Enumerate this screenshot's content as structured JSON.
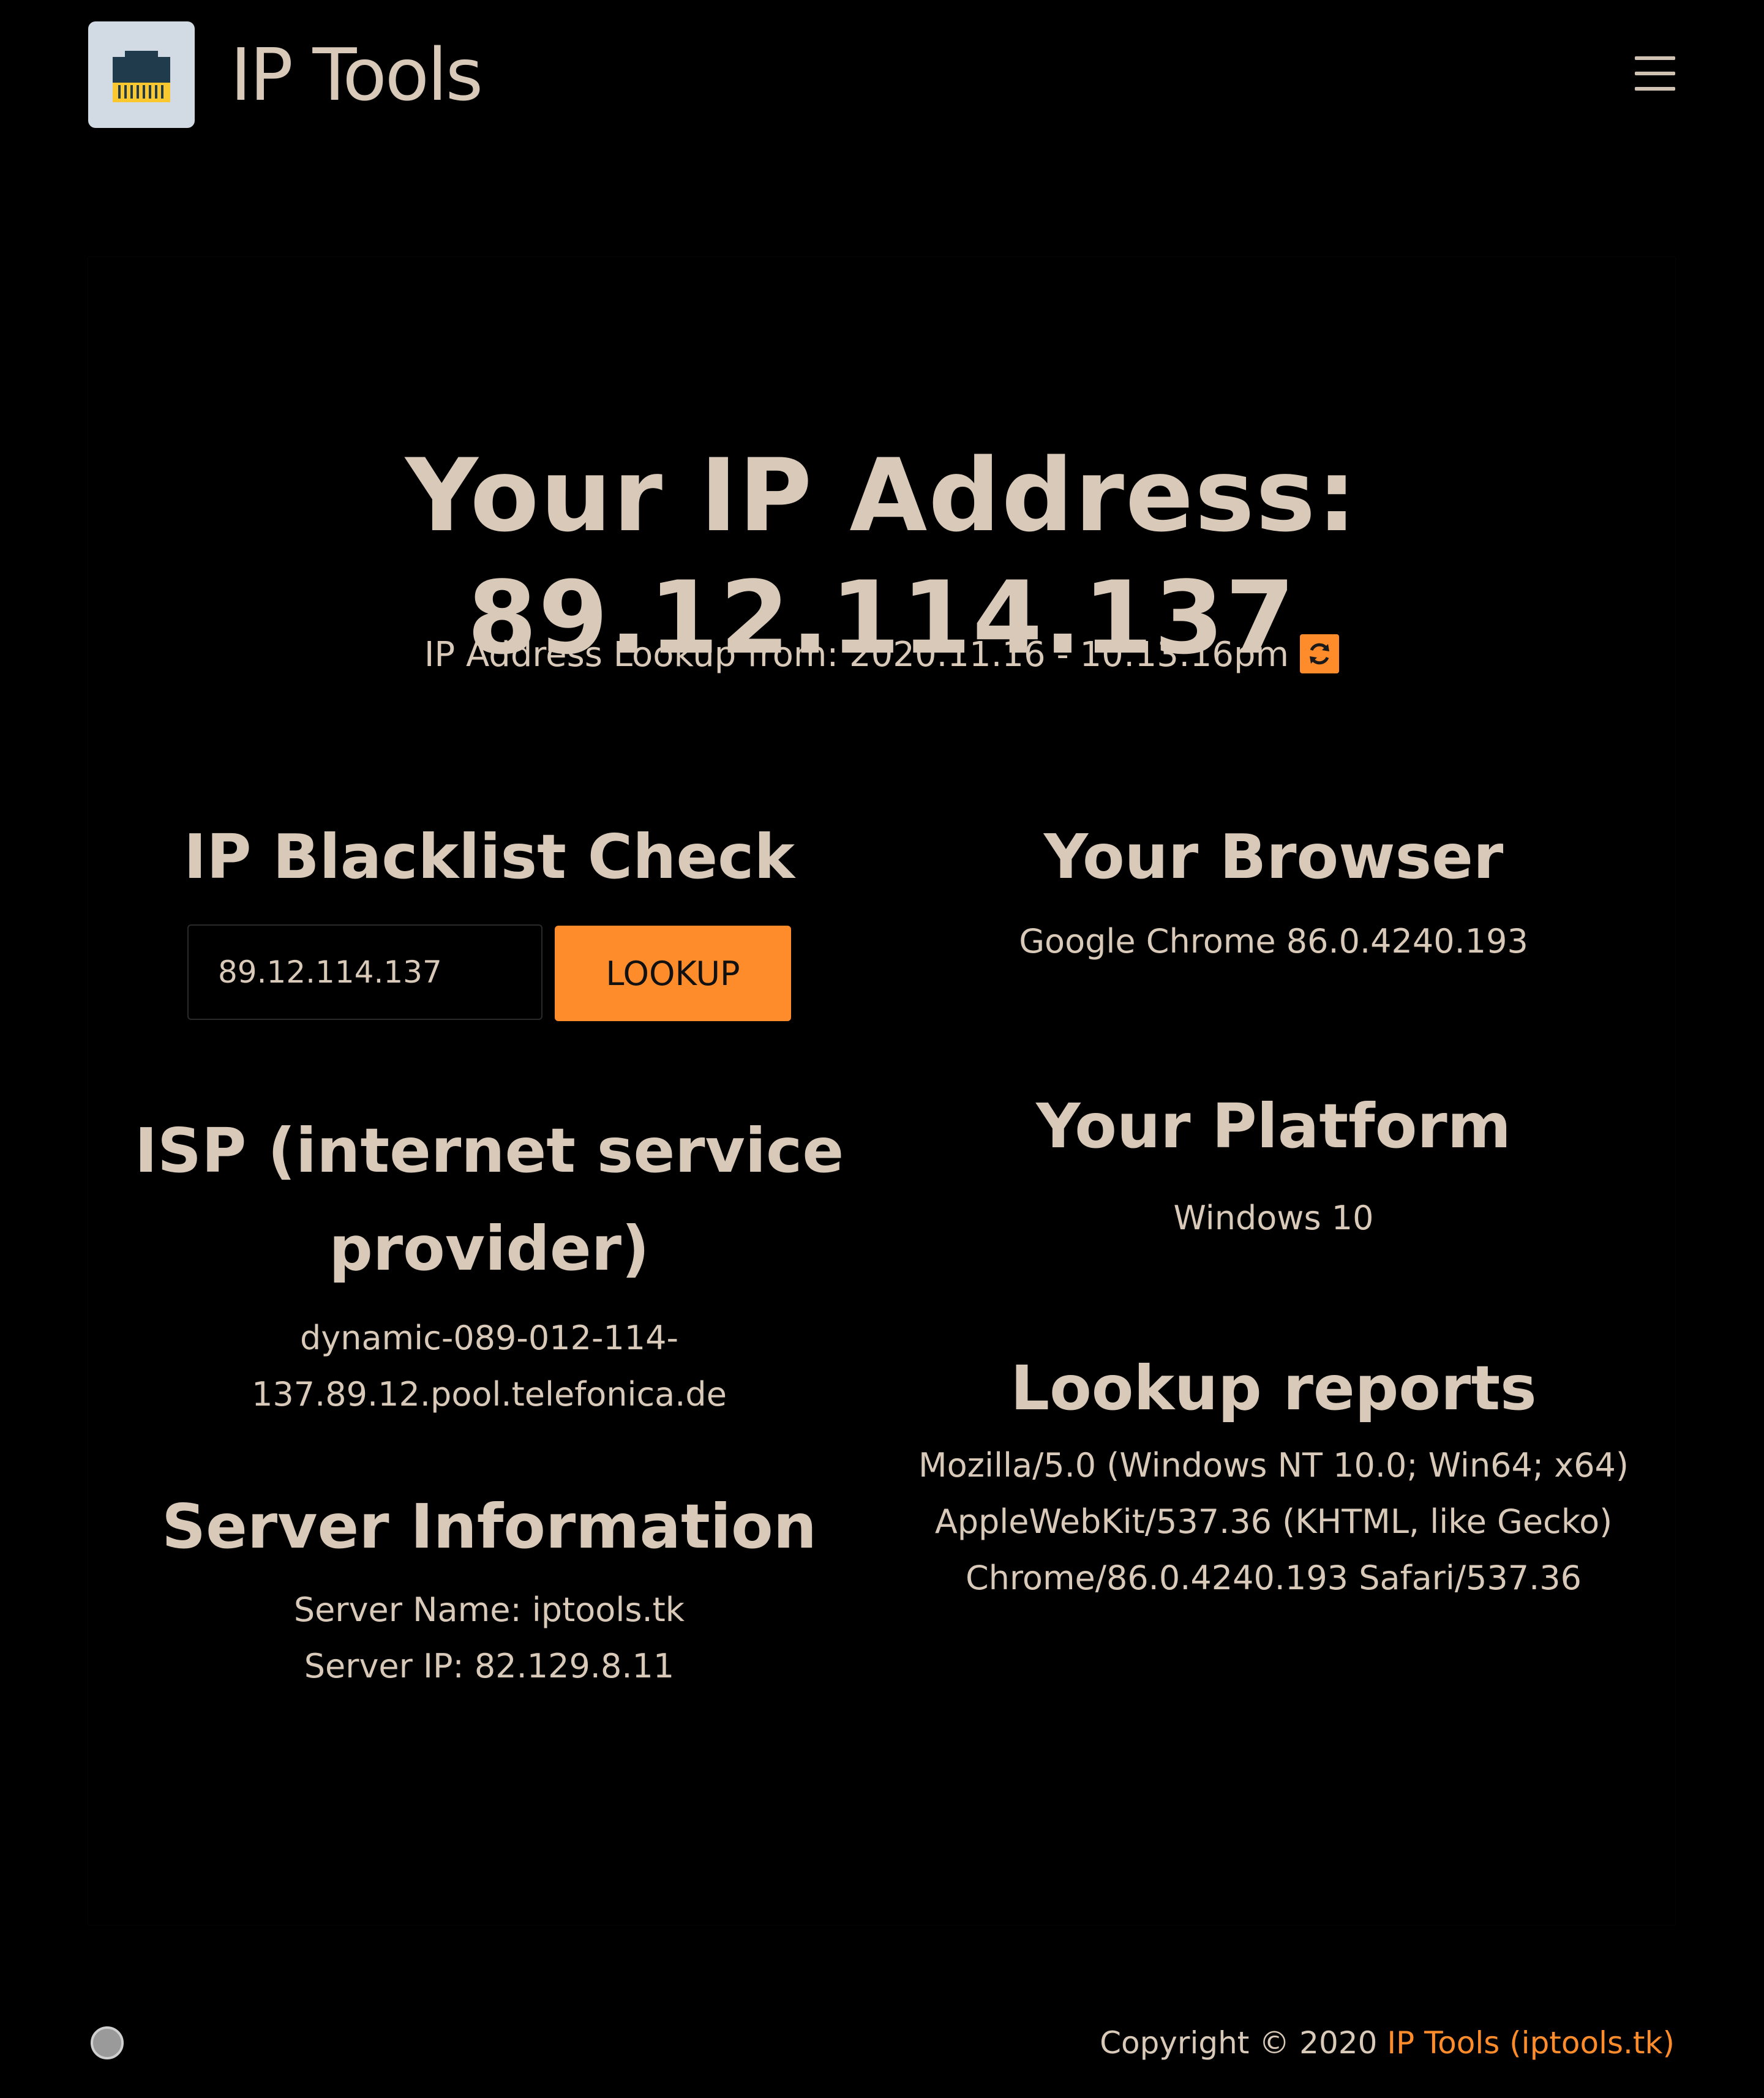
{
  "header": {
    "brand": "IP Tools",
    "logo_icon": "ethernet-port-icon",
    "menu_icon": "hamburger-menu-icon"
  },
  "main": {
    "ip_title": "Your IP Address: 89.12.114.137",
    "lookup_line": "IP Address Lookup from: 2020.11.16 - 10:13:16pm",
    "refresh_icon": "refresh-icon",
    "blacklist": {
      "heading": "IP Blacklist Check",
      "input_value": "89.12.114.137",
      "button_label": "LOOKUP"
    },
    "isp": {
      "heading_line1": "ISP (internet service",
      "heading_line2": "provider)",
      "line1": "dynamic-089-012-114-",
      "line2": "137.89.12.pool.telefonica.de"
    },
    "server": {
      "heading": "Server Information",
      "name": "Server Name: iptools.tk",
      "ip": "Server IP: 82.129.8.11"
    },
    "browser": {
      "heading": "Your Browser",
      "value": "Google Chrome 86.0.4240.193"
    },
    "platform": {
      "heading": "Your Platform",
      "value": "Windows 10"
    },
    "reports": {
      "heading": "Lookup reports",
      "line1": "Mozilla/5.0 (Windows NT 10.0; Win64; x64)",
      "line2": "AppleWebKit/537.36 (KHTML, like Gecko)",
      "line3": "Chrome/86.0.4240.193 Safari/537.36"
    }
  },
  "footer": {
    "copyright_prefix": "Copyright © 2020 ",
    "copyright_link": "IP Tools (iptools.tk)"
  },
  "colors": {
    "background": "#000000",
    "text": "#d9c9b8",
    "accent": "#ff8c2b"
  }
}
